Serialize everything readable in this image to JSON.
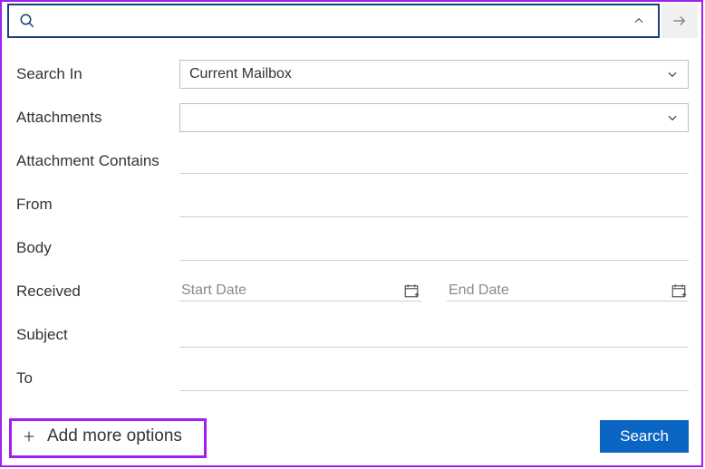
{
  "searchbar": {
    "query": "",
    "placeholder": ""
  },
  "fields": {
    "search_in": {
      "label": "Search In",
      "value": "Current Mailbox"
    },
    "attachments": {
      "label": "Attachments",
      "value": ""
    },
    "attachment_contains": {
      "label": "Attachment Contains",
      "value": ""
    },
    "from": {
      "label": "From",
      "value": ""
    },
    "body": {
      "label": "Body",
      "value": ""
    },
    "received": {
      "label": "Received",
      "start_placeholder": "Start Date",
      "end_placeholder": "End Date"
    },
    "subject": {
      "label": "Subject",
      "value": ""
    },
    "to": {
      "label": "To",
      "value": ""
    }
  },
  "footer": {
    "add_more": "Add more options",
    "search": "Search"
  }
}
